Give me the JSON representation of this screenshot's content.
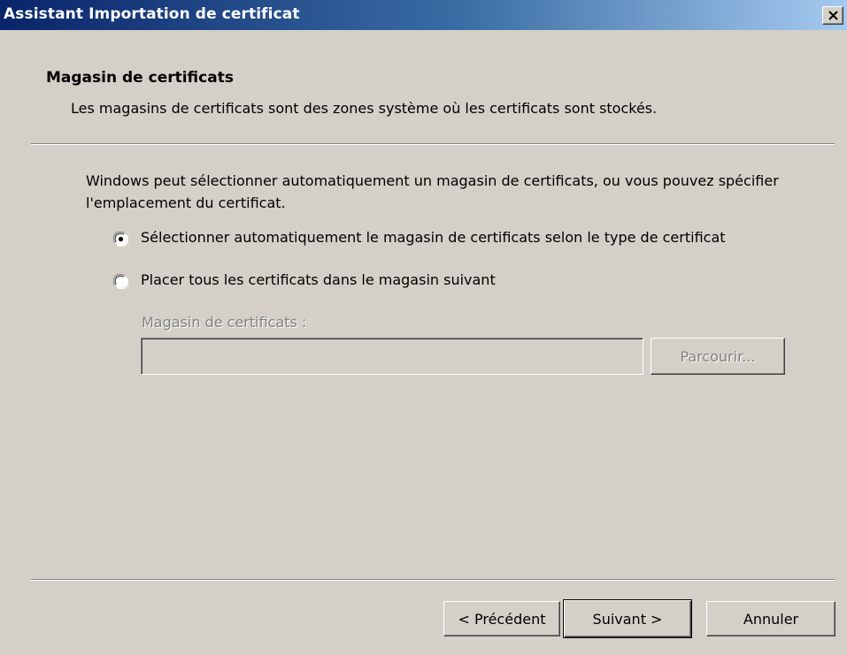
{
  "window": {
    "title": "Assistant Importation de certificat",
    "close_glyph": "×"
  },
  "header": {
    "title": "Magasin de certificats",
    "subtitle": "Les magasins de certificats sont des zones système où les certificats sont stockés."
  },
  "body": {
    "description": "Windows peut sélectionner automatiquement un magasin de certificats, ou vous pouvez spécifier l'emplacement du certificat.",
    "options": [
      {
        "label": "Sélectionner automatiquement le magasin de certificats selon le type de certificat",
        "selected": true
      },
      {
        "label": "Placer tous les certificats dans le magasin suivant",
        "selected": false
      }
    ],
    "store_field": {
      "label": "Magasin de certificats :",
      "value": "",
      "enabled": false
    },
    "browse_label": "Parcourir..."
  },
  "footer": {
    "prev_label": "< Précédent",
    "next_label": "Suivant >",
    "cancel_label": "Annuler"
  },
  "colors": {
    "titlebar_start": "#0a246a",
    "titlebar_end": "#a6caf0",
    "face": "#d4d0c8",
    "disabled_text": "#808080"
  },
  "icons": {
    "close": "close-icon",
    "radio_selected": "radio-selected-icon",
    "radio_empty": "radio-empty-icon"
  }
}
